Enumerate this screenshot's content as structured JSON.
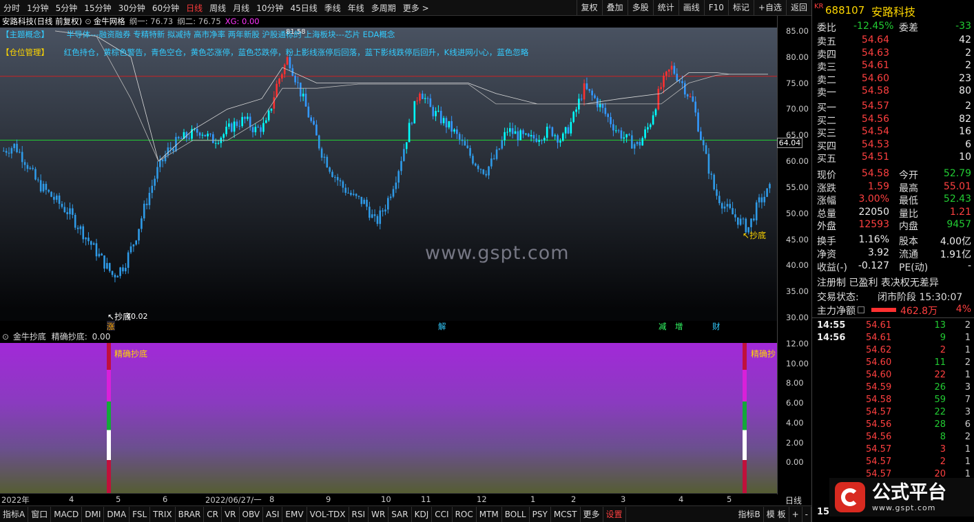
{
  "periods": [
    "分时",
    "1分钟",
    "5分钟",
    "15分钟",
    "30分钟",
    "60分钟",
    "日线",
    "周线",
    "月线",
    "10分钟",
    "45日线",
    "季线",
    "年线",
    "多周期",
    "更多 >"
  ],
  "toolbar_right": [
    "复权",
    "叠加",
    "多股",
    "统计",
    "画线",
    "F10",
    "标记",
    "+自选",
    "返回"
  ],
  "chart_title": {
    "stock": "安路科技(日线 前复权)",
    "indicator": "金牛网格",
    "v1": "纲一: 76.73",
    "v2": "纲二: 76.75",
    "v3": "XG: 0.00"
  },
  "overlay": {
    "concept_tag": "【主题概念】",
    "concept_text": "半导体---融资融券 专精特新 拟减持 高市净率 两年新股 沪股通标的 上海板块---芯片 EDA概念",
    "position_tag": "【仓位管理】",
    "position_text": "红色持仓，黄棕色警告，青色空仓，黄色芯涨停，蓝色芯跌停，粉上影线涨停后回落，蓝下影线跌停后回升，K线进网小心，蓝色忽略"
  },
  "price_labels": {
    "bottom1": "抄底",
    "bottom1_val": "40.02",
    "bottom2": "抄底",
    "high_val": "81.58",
    "level": "64.04"
  },
  "signals": {
    "s1": "涨",
    "s2": "解",
    "s3": "减",
    "s4": "增",
    "s5": "财"
  },
  "y_ticks": [
    "85.00",
    "80.00",
    "75.00",
    "70.00",
    "65.00",
    "60.00",
    "55.00",
    "50.00",
    "45.00",
    "40.00",
    "35.00",
    "30.00"
  ],
  "sub_y_ticks": [
    "12.00",
    "10.00",
    "8.00",
    "6.00",
    "4.00",
    "2.00",
    "0.00"
  ],
  "sub": {
    "title": "金牛抄底",
    "label": "精确抄底:",
    "value": "0.00",
    "tag1": "精确抄底",
    "tag2": "精确抄"
  },
  "x_ticks": [
    "2022年",
    "4",
    "5",
    "6",
    "2022/06/27/一",
    "8",
    "9",
    "10",
    "11",
    "12",
    "1",
    "2",
    "3",
    "4",
    "5"
  ],
  "x_period_label": "日线",
  "bottom_tabs": [
    "指标A",
    "窗口",
    "MACD",
    "DMI",
    "DMA",
    "FSL",
    "TRIX",
    "BRAR",
    "CR",
    "VR",
    "OBV",
    "ASI",
    "EMV",
    "VOL-TDX",
    "RSI",
    "WR",
    "SAR",
    "KDJ",
    "CCI",
    "ROC",
    "MTM",
    "BOLL",
    "PSY",
    "MCST",
    "更多",
    "设置"
  ],
  "bottom_right": [
    "指标B",
    "模 板",
    "+",
    "-"
  ],
  "watermark": "www.gspt.com",
  "quote": {
    "badge": "KR",
    "code": "688107",
    "name": "安路科技",
    "weibi_label": "委比",
    "weibi": "-12.45%",
    "weicha_label": "委差",
    "weicha": "-33",
    "sells": [
      {
        "l": "卖五",
        "p": "54.64",
        "v": "42"
      },
      {
        "l": "卖四",
        "p": "54.63",
        "v": "2"
      },
      {
        "l": "卖三",
        "p": "54.61",
        "v": "2"
      },
      {
        "l": "卖二",
        "p": "54.60",
        "v": "23"
      },
      {
        "l": "卖一",
        "p": "54.58",
        "v": "80"
      }
    ],
    "buys": [
      {
        "l": "买一",
        "p": "54.57",
        "v": "2"
      },
      {
        "l": "买二",
        "p": "54.56",
        "v": "82"
      },
      {
        "l": "买三",
        "p": "54.54",
        "v": "16"
      },
      {
        "l": "买四",
        "p": "54.53",
        "v": "6"
      },
      {
        "l": "买五",
        "p": "54.51",
        "v": "10"
      }
    ],
    "stats": [
      {
        "a": "现价",
        "b": "54.58",
        "bc": "red",
        "c": "今开",
        "d": "52.79",
        "dc": "grn"
      },
      {
        "a": "涨跌",
        "b": "1.59",
        "bc": "red",
        "c": "最高",
        "d": "55.01",
        "dc": "red"
      },
      {
        "a": "涨幅",
        "b": "3.00%",
        "bc": "red",
        "c": "最低",
        "d": "52.43",
        "dc": "grn"
      },
      {
        "a": "总量",
        "b": "22050",
        "bc": "wht",
        "c": "量比",
        "d": "1.21",
        "dc": "red"
      },
      {
        "a": "外盘",
        "b": "12593",
        "bc": "red",
        "c": "内盘",
        "d": "9457",
        "dc": "grn"
      }
    ],
    "stats2": [
      {
        "a": "换手",
        "b": "1.16%",
        "bc": "wht",
        "c": "股本",
        "d": "4.00亿",
        "dc": "wht"
      },
      {
        "a": "净资",
        "b": "3.92",
        "bc": "wht",
        "c": "流通",
        "d": "1.91亿",
        "dc": "wht"
      },
      {
        "a": "收益(-)",
        "b": "-0.127",
        "bc": "wht",
        "c": "PE(动)",
        "d": "-",
        "dc": "wht"
      }
    ],
    "reg": "注册制 已盈利 表决权无差异",
    "status_label": "交易状态:",
    "status": "闭市阶段 15:30:07",
    "flow_label": "主力净额",
    "flow": "462.8万",
    "flow_pct": "4%",
    "ticks": [
      {
        "t": "14:55",
        "p": "54.61",
        "v": "13",
        "vc": "grn",
        "n": "2"
      },
      {
        "t": "14:56",
        "p": "54.61",
        "v": "9",
        "vc": "grn",
        "n": "1"
      },
      {
        "t": "",
        "p": "54.62",
        "v": "2",
        "vc": "red",
        "n": "1"
      },
      {
        "t": "",
        "p": "54.60",
        "v": "11",
        "vc": "grn",
        "n": "2"
      },
      {
        "t": "",
        "p": "54.60",
        "v": "22",
        "vc": "red",
        "n": "1"
      },
      {
        "t": "",
        "p": "54.59",
        "v": "26",
        "vc": "grn",
        "n": "3"
      },
      {
        "t": "",
        "p": "54.58",
        "v": "59",
        "vc": "grn",
        "n": "7"
      },
      {
        "t": "",
        "p": "54.57",
        "v": "22",
        "vc": "grn",
        "n": "3"
      },
      {
        "t": "",
        "p": "54.56",
        "v": "28",
        "vc": "grn",
        "n": "6"
      },
      {
        "t": "",
        "p": "54.56",
        "v": "8",
        "vc": "grn",
        "n": "2"
      },
      {
        "t": "",
        "p": "54.57",
        "v": "3",
        "vc": "red",
        "n": "1"
      },
      {
        "t": "",
        "p": "54.57",
        "v": "2",
        "vc": "red",
        "n": "1"
      },
      {
        "t": "",
        "p": "54.57",
        "v": "20",
        "vc": "red",
        "n": "1"
      }
    ],
    "last_time": "15:"
  },
  "logo_text": "公式平台",
  "logo_url": "www.gspt.com",
  "chart_data": {
    "type": "candlestick",
    "ylim": [
      30,
      85
    ],
    "y_ticks": [
      85,
      80,
      75,
      70,
      65,
      60,
      55,
      50,
      45,
      40,
      35,
      30
    ],
    "ref_lines": [
      {
        "value": 64.04,
        "color": "#22cc33"
      },
      {
        "value": 76.3,
        "color": "#cc2222"
      }
    ],
    "close_path": [
      62,
      63,
      60,
      56,
      54,
      52,
      50,
      47,
      44,
      41,
      38,
      40,
      45,
      52,
      58,
      62,
      64,
      65,
      66,
      64,
      65,
      67,
      68,
      66,
      67,
      75,
      80,
      74,
      68,
      62,
      58,
      55,
      53,
      52,
      48,
      52,
      58,
      66,
      74,
      70,
      68,
      66,
      63,
      60,
      58,
      61,
      66,
      65,
      64,
      65,
      66,
      64,
      68,
      74,
      72,
      69,
      66,
      64,
      63,
      67,
      74,
      78,
      75,
      71,
      62,
      54,
      51,
      49,
      47,
      52,
      54.58
    ],
    "colors": {
      "up": "#ff3030",
      "down": "#3399ff",
      "cyan": "#00ffff"
    }
  }
}
